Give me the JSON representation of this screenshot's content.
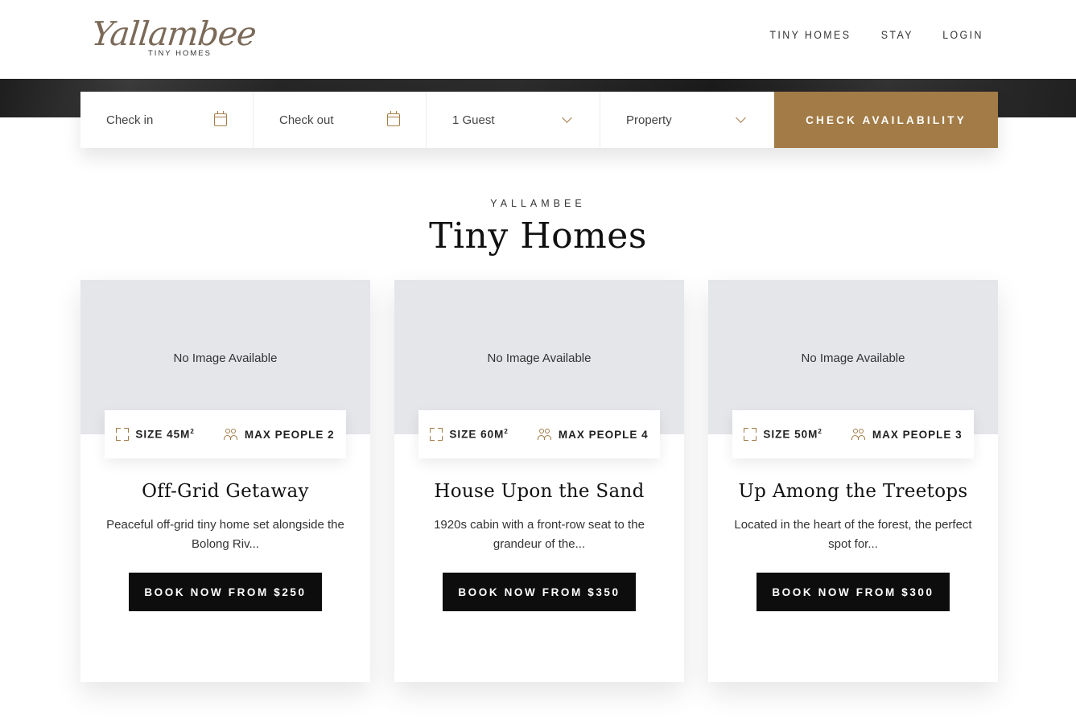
{
  "brand": {
    "logo_script": "Yallambee",
    "logo_sub": "TINY HOMES"
  },
  "nav": {
    "items": [
      "TINY HOMES",
      "STAY",
      "LOGIN"
    ]
  },
  "booking": {
    "check_in": "Check in",
    "check_out": "Check out",
    "guests": "1 Guest",
    "property": "Property",
    "button": "CHECK AVAILABILITY"
  },
  "section": {
    "eyebrow": "YALLAMBEE",
    "title": "Tiny Homes"
  },
  "cards": [
    {
      "image_text": "No Image Available",
      "size": "SIZE 45M",
      "size_sup": "2",
      "people": "MAX PEOPLE 2",
      "name": "Off-Grid Getaway",
      "desc": "Peaceful off-grid tiny home set alongside the Bolong Riv...",
      "button": "BOOK NOW FROM $250"
    },
    {
      "image_text": "No Image Available",
      "size": "SIZE 60M",
      "size_sup": "2",
      "people": "MAX PEOPLE 4",
      "name": "House Upon the Sand",
      "desc": "1920s cabin with a front-row seat to the grandeur of the...",
      "button": "BOOK NOW FROM $350"
    },
    {
      "image_text": "No Image Available",
      "size": "SIZE 50M",
      "size_sup": "2",
      "people": "MAX PEOPLE 3",
      "name": "Up Among the Treetops",
      "desc": "Located in the heart of the forest, the perfect spot for...",
      "button": "BOOK NOW FROM $300"
    }
  ],
  "colors": {
    "accent": "#a27b46",
    "button_dark": "#0d0d0d",
    "image_placeholder": "#e5e6ea",
    "logo": "#7b6a58"
  }
}
